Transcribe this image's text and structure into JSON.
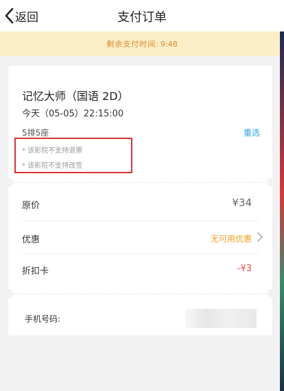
{
  "header": {
    "back_label": "返回",
    "title": "支付订单"
  },
  "timer": {
    "label": "剩余支付时间:",
    "time": "9:48"
  },
  "order": {
    "movie_name": "记忆大师（国语 2D）",
    "show_time": "今天（05-05）22:15:00",
    "seat": "5排5座",
    "reselect_label": "重选",
    "notes": [
      "* 该影院不支持退票",
      "* 该影院不支持改签"
    ]
  },
  "pricing": {
    "original_price_label": "原价",
    "original_price_value": "¥34",
    "discount_label": "优惠",
    "discount_value": "无可用优惠",
    "discount_card_label": "折扣卡",
    "discount_card_value": "-¥3"
  },
  "phone": {
    "label": "手机号码:"
  },
  "colors": {
    "accent_blue": "#2aa3e8",
    "accent_orange": "#f0a020",
    "accent_red": "#ee5544",
    "timer_bg": "#fcefc7",
    "highlight_border": "#e03030"
  }
}
